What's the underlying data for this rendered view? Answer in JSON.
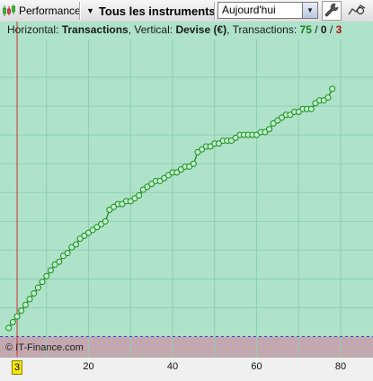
{
  "toolbar": {
    "performance_label": "Performance",
    "instruments_label": "Tous les instruments",
    "period_value": "Aujourd'hui",
    "icons": [
      "bar-chart-icon",
      "dropdown-arrow-icon",
      "wrench-icon",
      "zoom-icon"
    ]
  },
  "info": {
    "horizontal_label": "Horizontal:",
    "horizontal_value": "Transactions",
    "vertical_label": ", Vertical:",
    "vertical_value": "Devise (€)",
    "transactions_label": ", Transactions:",
    "count_total": "75",
    "count_mid": "0",
    "count_red": "3",
    "slash": " / "
  },
  "copyright": "© IT-Finance.com",
  "colors": {
    "plot_bg": "#aee2c9",
    "loss_band": "#c4a8b0",
    "line": "#1d8a1d",
    "cursor": "#d23030",
    "dashed": "#2b4fd8"
  },
  "chart_data": {
    "type": "line",
    "xlabel": "",
    "ylabel": "",
    "xlim": [
      0,
      82
    ],
    "ylim": [
      -7,
      100
    ],
    "grid": true,
    "x_ticks": [
      "20",
      "40",
      "60",
      "80"
    ],
    "cursor_x_label": "3",
    "baseline_y": 0,
    "x": [
      1,
      2,
      3,
      4,
      5,
      6,
      7,
      8,
      9,
      10,
      11,
      12,
      13,
      14,
      15,
      16,
      17,
      18,
      19,
      20,
      21,
      22,
      23,
      24,
      25,
      26,
      27,
      28,
      29,
      30,
      31,
      32,
      33,
      34,
      35,
      36,
      37,
      38,
      39,
      40,
      41,
      42,
      43,
      44,
      45,
      46,
      47,
      48,
      49,
      50,
      51,
      52,
      53,
      54,
      55,
      56,
      57,
      58,
      59,
      60,
      61,
      62,
      63,
      64,
      65,
      66,
      67,
      68,
      69,
      70,
      71,
      72,
      73,
      74,
      75,
      76,
      77,
      78
    ],
    "values": [
      3,
      5,
      7,
      9,
      11,
      13,
      15,
      17,
      19,
      21,
      23,
      25,
      26,
      28,
      29,
      31,
      32,
      34,
      35,
      36,
      37,
      38,
      39,
      40,
      44,
      45,
      46,
      46,
      47,
      47,
      48,
      49,
      51,
      52,
      53,
      54,
      54,
      55,
      56,
      57,
      57,
      58,
      59,
      59,
      60,
      64,
      65,
      66,
      66,
      67,
      67,
      68,
      68,
      68,
      69,
      70,
      70,
      70,
      70,
      70,
      71,
      71,
      72,
      74,
      75,
      76,
      77,
      77,
      78,
      78,
      79,
      79,
      79,
      81,
      82,
      82,
      83,
      86
    ]
  }
}
